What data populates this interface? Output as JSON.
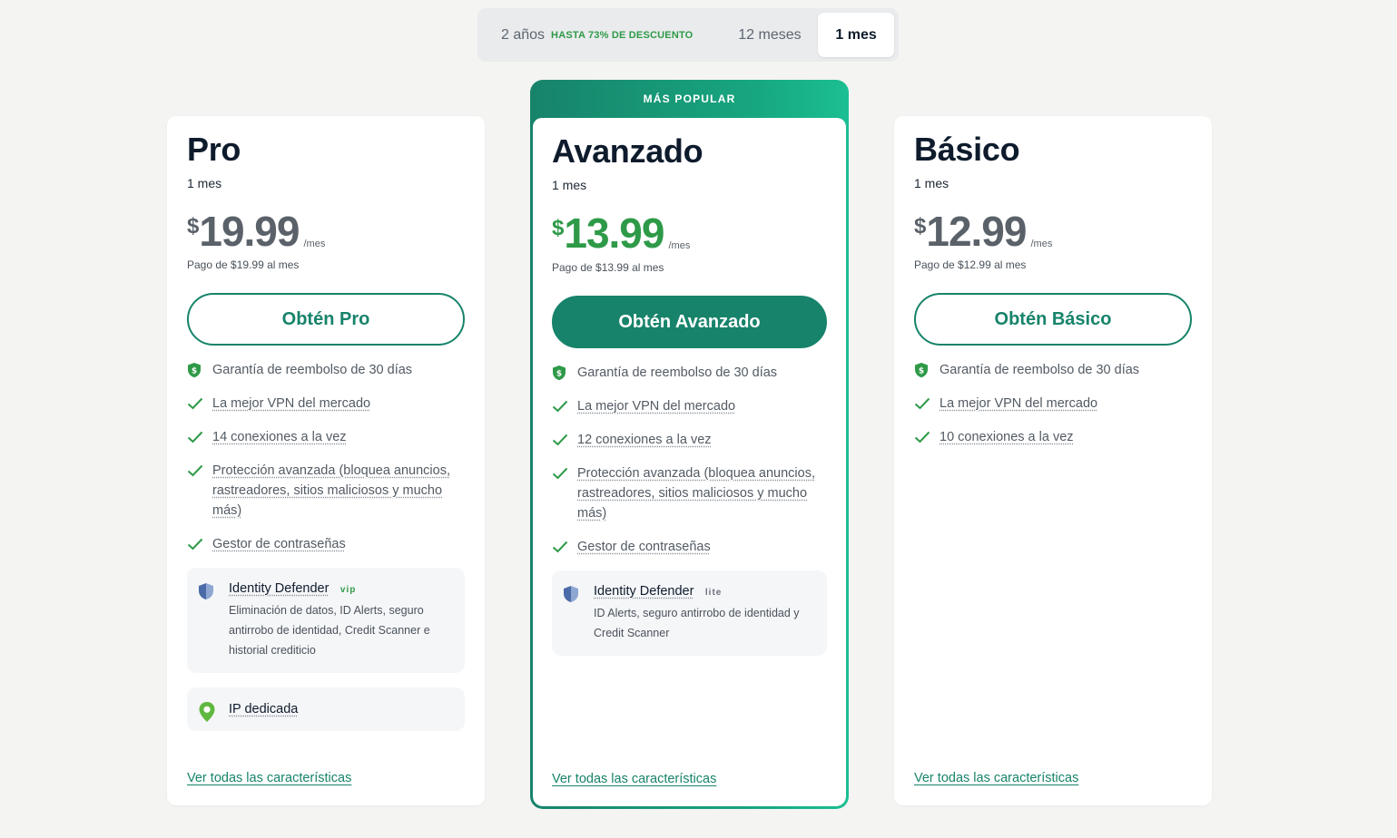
{
  "period_toggle": {
    "two_years": "2 años",
    "discount": "HASTA 73% DE DESCUENTO",
    "twelve_months": "12 meses",
    "one_month": "1 mes"
  },
  "colors": {
    "brand_green": "#17836a",
    "price_green": "#2e9a48",
    "check_green": "#2e9a48"
  },
  "plans": {
    "pro": {
      "name": "Pro",
      "period": "1 mes",
      "currency": "$",
      "price": "19.99",
      "per": "/mes",
      "billed": "Pago de $19.99 al mes",
      "cta": "Obtén Pro",
      "features": [
        "Garantía de reembolso de 30 días",
        "La mejor VPN del mercado",
        "14 conexiones a la vez",
        "Protección avanzada (bloquea anuncios, rastreadores, sitios maliciosos y mucho más)",
        "Gestor de contraseñas"
      ],
      "addon": {
        "title": "Identity Defender",
        "tag": "vip",
        "desc": "Eliminación de datos, ID Alerts, seguro antirrobo de identidad, Credit Scanner e historial crediticio"
      },
      "addon2": {
        "title": "IP dedicada"
      },
      "see_all": "Ver todas las características"
    },
    "advanced": {
      "badge": "MÁS POPULAR",
      "name": "Avanzado",
      "period": "1 mes",
      "currency": "$",
      "price": "13.99",
      "per": "/mes",
      "billed": "Pago de $13.99 al mes",
      "cta": "Obtén Avanzado",
      "features": [
        "Garantía de reembolso de 30 días",
        "La mejor VPN del mercado",
        "12 conexiones a la vez",
        "Protección avanzada (bloquea anuncios, rastreadores, sitios maliciosos y mucho más)",
        "Gestor de contraseñas"
      ],
      "addon": {
        "title": "Identity Defender",
        "tag": "lite",
        "desc": "ID Alerts, seguro antirrobo de identidad y Credit Scanner"
      },
      "see_all": "Ver todas las características"
    },
    "basic": {
      "name": "Básico",
      "period": "1 mes",
      "currency": "$",
      "price": "12.99",
      "per": "/mes",
      "billed": "Pago de $12.99 al mes",
      "cta": "Obtén Básico",
      "features": [
        "Garantía de reembolso de 30 días",
        "La mejor VPN del mercado",
        "10 conexiones a la vez"
      ],
      "see_all": "Ver todas las características"
    }
  }
}
